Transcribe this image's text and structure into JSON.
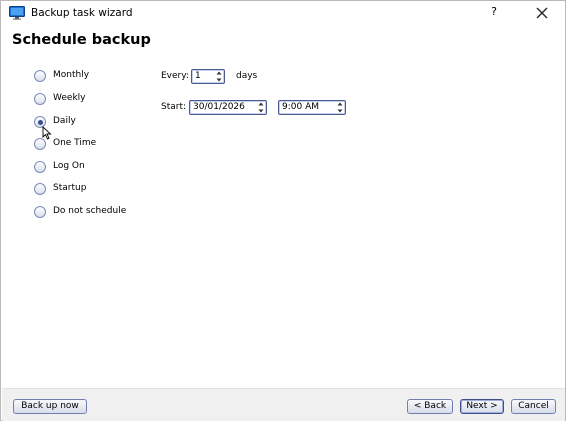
{
  "window": {
    "title": "Backup task wizard",
    "help_label": "?",
    "close_icon": "close-icon",
    "app_icon": "monitor-icon"
  },
  "page": {
    "title": "Schedule backup"
  },
  "schedule": {
    "options": [
      "Monthly",
      "Weekly",
      "Daily",
      "One Time",
      "Log On",
      "Startup",
      "Do not schedule"
    ],
    "selected": "Daily"
  },
  "daily": {
    "every_label": "Every:",
    "every_value": "1",
    "every_unit": "days",
    "start_label": "Start:",
    "start_date": "30/01/2026",
    "start_time": "9:00 AM"
  },
  "footer": {
    "back_up_now": "Back up now",
    "back": "< Back",
    "next": "Next >",
    "cancel": "Cancel"
  },
  "colors": {
    "accent_border": "#4a5a8c",
    "radio_dot": "#3a4e8c",
    "footer_bg": "#f0f0f0"
  }
}
